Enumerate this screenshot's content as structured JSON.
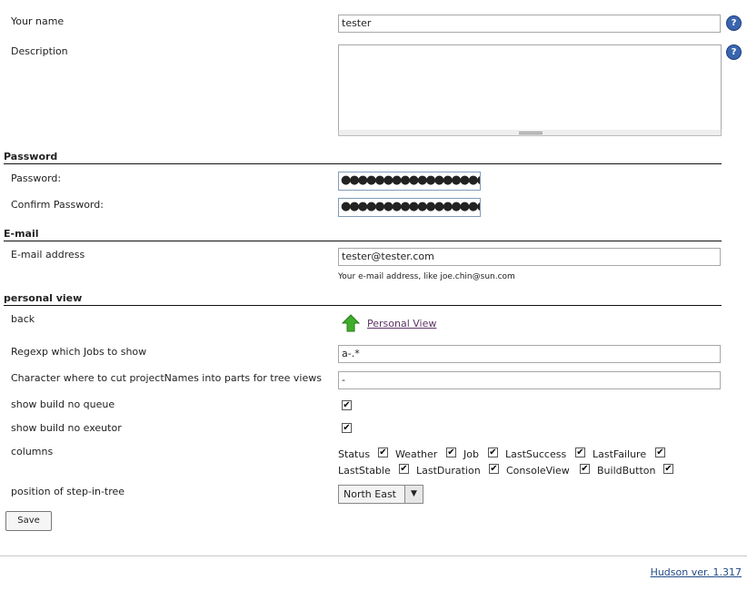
{
  "name_field": {
    "label": "Your name",
    "value": "tester"
  },
  "description_field": {
    "label": "Description",
    "value": ""
  },
  "password_section": {
    "title": "Password",
    "password_label": "Password:",
    "password_value": "●●●●●●●●●●●●●●●●●●●●●●●●●●●●",
    "confirm_label": "Confirm Password:",
    "confirm_value": "●●●●●●●●●●●●●●●●●●●●●●●●●●●●"
  },
  "email_section": {
    "title": "E-mail",
    "label": "E-mail address",
    "value": "tester@tester.com",
    "hint": "Your e-mail address, like joe.chin@sun.com"
  },
  "personal_view": {
    "title": "personal view",
    "back_label": "back",
    "back_link": "Personal View",
    "regex_label": "Regexp which Jobs to show",
    "regex_value": "a-.*",
    "cut_label": "Character where to cut projectNames into parts for tree views",
    "cut_value": "-",
    "build_queue_label": "show build no queue",
    "build_queue_checked": true,
    "build_executor_label": "show build no exeutor",
    "build_executor_checked": true,
    "columns_label": "columns",
    "columns": [
      {
        "label": "Status",
        "checked": true
      },
      {
        "label": "Weather",
        "checked": true
      },
      {
        "label": "Job",
        "checked": true
      },
      {
        "label": "LastSuccess",
        "checked": true
      },
      {
        "label": "LastFailure",
        "checked": true
      },
      {
        "label": "LastStable",
        "checked": true
      },
      {
        "label": "LastDuration",
        "checked": true
      },
      {
        "label": "ConsoleView",
        "checked": true
      },
      {
        "label": "BuildButton",
        "checked": true
      }
    ],
    "position_label": "position of step-in-tree",
    "position_value": "North East"
  },
  "save_button": "Save",
  "footer": {
    "version_link": "Hudson ver. 1.317"
  },
  "icons": {
    "help": "help-icon",
    "back": "green-up-arrow-icon",
    "select": "dropdown-arrow-icon"
  }
}
